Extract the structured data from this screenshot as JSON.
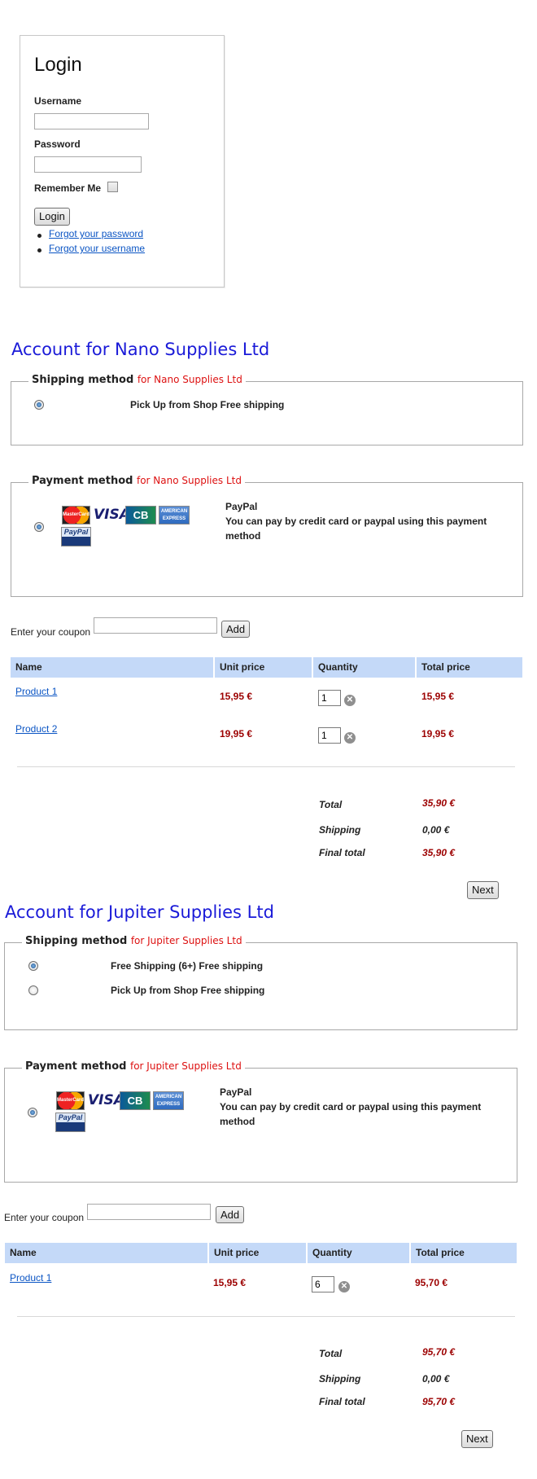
{
  "login": {
    "title": "Login",
    "username_label": "Username",
    "password_label": "Password",
    "remember_label": "Remember Me",
    "login_button": "Login",
    "links": [
      "Forgot your password",
      "Forgot your username"
    ]
  },
  "common": {
    "shipping_legend": "Shipping method",
    "payment_legend": "Payment method",
    "coupon_label": "Enter your coupon",
    "coupon_button": "Add",
    "columns": [
      "Name",
      "Unit price",
      "Quantity",
      "Total price"
    ],
    "total_label": "Total",
    "shipping_label": "Shipping",
    "final_total_label": "Final total",
    "next_button": "Next",
    "cards": {
      "mastercard": "MasterCard",
      "visa": "VISA",
      "cb": "CB",
      "amex": "AMERICAN EXPRESS",
      "paypal": "PayPal"
    }
  },
  "accounts": [
    {
      "title": "Account for Nano Supplies Ltd",
      "vendor_tag": "for Nano Supplies Ltd",
      "shipping_options": [
        {
          "label": "Pick Up from Shop Free shipping",
          "checked": true
        }
      ],
      "payment": {
        "name": "PayPal",
        "description": "You can pay by credit card or paypal using this payment method"
      },
      "products": [
        {
          "name": "Product 1",
          "unit_price": "15,95 €",
          "quantity": "1",
          "total": "15,95 €"
        },
        {
          "name": "Product 2",
          "unit_price": "19,95 €",
          "quantity": "1",
          "total": "19,95 €"
        }
      ],
      "total": "35,90 €",
      "shipping": "0,00 €",
      "final_total": "35,90 €"
    },
    {
      "title": "Account for Jupiter Supplies Ltd",
      "vendor_tag": "for Jupiter Supplies Ltd",
      "shipping_options": [
        {
          "label": "Free Shipping (6+) Free shipping",
          "checked": true
        },
        {
          "label": "Pick Up from Shop Free shipping",
          "checked": false
        }
      ],
      "payment": {
        "name": "PayPal",
        "description": "You can pay by credit card or paypal using this payment method"
      },
      "products": [
        {
          "name": "Product 1",
          "unit_price": "15,95 €",
          "quantity": "6",
          "total": "95,70 €"
        }
      ],
      "total": "95,70 €",
      "shipping": "0,00 €",
      "final_total": "95,70 €"
    }
  ]
}
